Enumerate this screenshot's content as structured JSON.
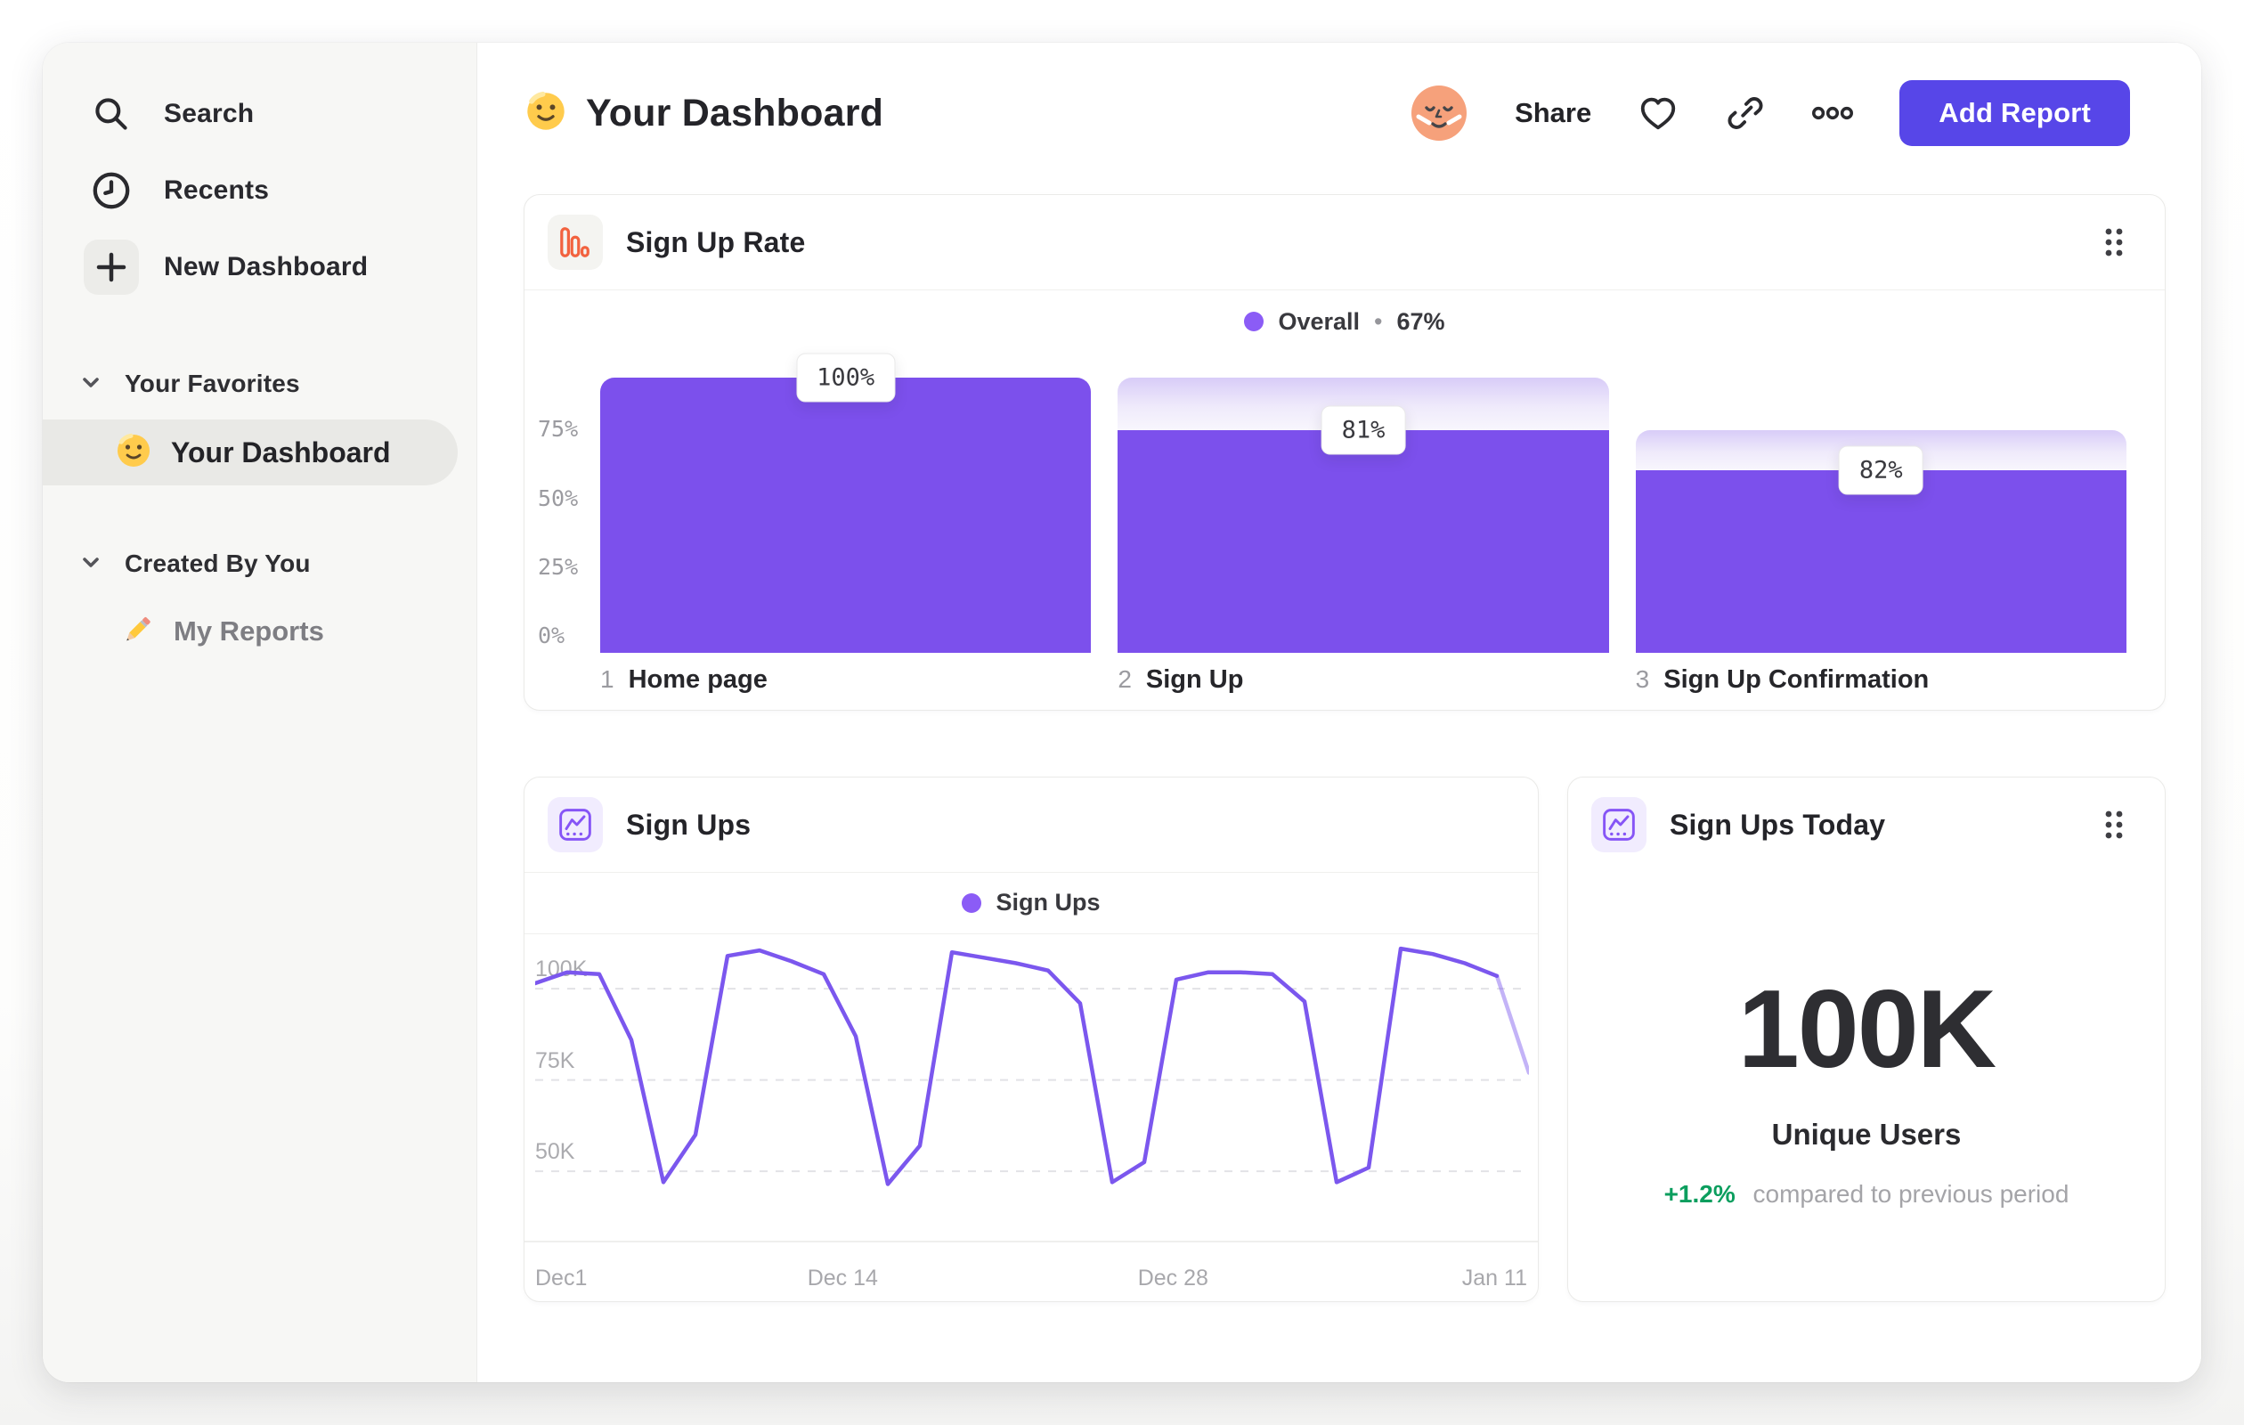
{
  "header": {
    "emoji": "🙂",
    "title": "Your Dashboard",
    "share_label": "Share",
    "add_report_label": "Add Report",
    "icons": [
      "avatar-face",
      "heart-icon",
      "link-icon",
      "more-options-icon"
    ]
  },
  "sidebar": {
    "nav": [
      {
        "icon": "search-icon",
        "label": "Search"
      },
      {
        "icon": "clock-icon",
        "label": "Recents"
      },
      {
        "icon": "plus-icon",
        "label": "New Dashboard"
      }
    ],
    "sections": [
      {
        "label": "Your Favorites",
        "items": [
          {
            "emoji": "🙂",
            "icon": "smiley-emoji",
            "label": "Your Dashboard",
            "selected": true
          }
        ]
      },
      {
        "label": "Created By You",
        "items": [
          {
            "emoji": "✏️",
            "icon": "pencil-emoji",
            "label": "My Reports",
            "selected": false
          }
        ]
      }
    ]
  },
  "cards": {
    "sign_up_rate": {
      "title": "Sign Up Rate",
      "icon": "bar-chart-icon",
      "legend": {
        "series": "Overall",
        "separator": "•",
        "value": "67%"
      },
      "chart_data": {
        "type": "funnel_bar",
        "title": "Sign Up Rate",
        "overall_conversion": "67%",
        "ylim": [
          0,
          100
        ],
        "y_ticks": [
          {
            "label": "75%",
            "value": 75
          },
          {
            "label": "50%",
            "value": 50
          },
          {
            "label": "25%",
            "value": 25
          },
          {
            "label": "0%",
            "value": 0
          }
        ],
        "steps": [
          {
            "index": "1",
            "label": "Home page",
            "conversion_label": "100%",
            "conversion_pct": 100,
            "overall_pct": 100,
            "prev_overall_pct": 100
          },
          {
            "index": "2",
            "label": "Sign Up",
            "conversion_label": "81%",
            "conversion_pct": 81,
            "overall_pct": 81,
            "prev_overall_pct": 100
          },
          {
            "index": "3",
            "label": "Sign Up Confirmation",
            "conversion_label": "82%",
            "conversion_pct": 82,
            "overall_pct": 66.4,
            "prev_overall_pct": 81
          }
        ],
        "bar_color": "#7C50EC"
      }
    },
    "sign_ups": {
      "title": "Sign Ups",
      "icon": "line-chart-icon",
      "legend": {
        "series": "Sign Ups"
      },
      "chart_data": {
        "type": "line",
        "title": "Sign Ups",
        "unit": "K",
        "y_domain": [
          31,
          112
        ],
        "y_ticks": [
          {
            "label": "100K",
            "value": 100
          },
          {
            "label": "75K",
            "value": 75
          },
          {
            "label": "50K",
            "value": 50
          }
        ],
        "x_labels": [
          {
            "label": "Dec1",
            "pos": 0
          },
          {
            "label": "Dec 14",
            "pos": 0.31
          },
          {
            "label": "Dec 28",
            "pos": 0.643
          },
          {
            "label": "Jan 11",
            "pos": 1
          }
        ],
        "series": [
          {
            "name": "Sign Ups",
            "values": [
              101.5,
              104.5,
              104,
              86,
              47,
              60,
              109,
              110.5,
              107.5,
              104,
              87,
              46.5,
              57,
              110,
              108.5,
              107,
              105,
              96,
              47,
              52.5,
              102.5,
              104.5,
              104.5,
              104,
              96.5,
              47,
              51,
              111,
              109.5,
              107,
              103.5,
              77
            ]
          }
        ],
        "grid": "dashed-horizontal",
        "legend_position": "top-center",
        "partial_last_segment": true,
        "line_color": "#7B57EE"
      }
    },
    "sign_ups_today": {
      "title": "Sign Ups Today",
      "icon": "line-chart-icon",
      "value": "100K",
      "metric_label": "Unique Users",
      "delta": "+1.2%",
      "delta_caption": "compared to previous period"
    }
  },
  "colors": {
    "accent_purple": "#7C50EC",
    "line_purple": "#7B57EE",
    "legend_dot": "#8B5CF6",
    "button_purple": "#5746E8",
    "positive_green": "#0B9E5E",
    "icon_orange": "#F2623F",
    "avatar_skin": "#F6A17B",
    "sidebar_bg": "#F7F7F5",
    "selected_pill": "#E9E9E6"
  }
}
